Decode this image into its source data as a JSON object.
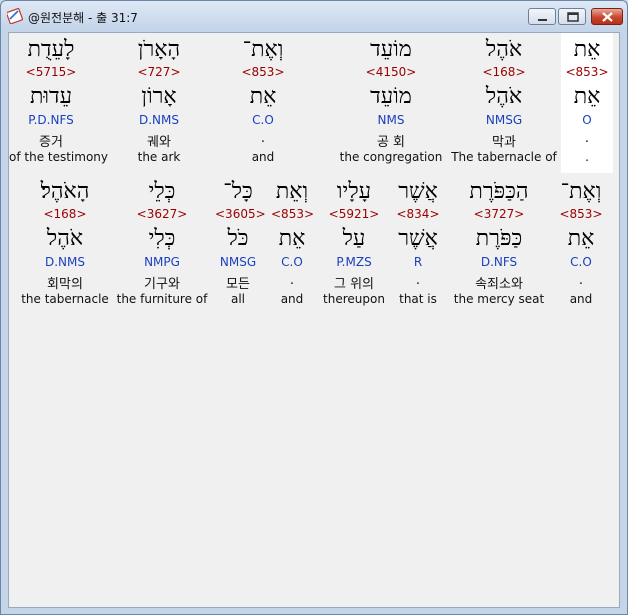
{
  "window": {
    "title": "@원전분해 - 출 31:7"
  },
  "row1": [
    {
      "surface": "לָעֵדֻת",
      "strong": "<5715>",
      "lemma": "עֵדוּת",
      "morph": "P.D.NFS",
      "korean": "증거",
      "english": "of the testimony"
    },
    {
      "surface": "הָאָרֹן",
      "strong": "<727>",
      "lemma": "אָרוֹן",
      "morph": "D.NMS",
      "korean": "궤와",
      "english": "the ark"
    },
    {
      "surface": "וְאֶת־",
      "strong": "<853>",
      "lemma": "אֵת",
      "morph": "C.O",
      "korean": ".",
      "english": "and"
    },
    {
      "surface": "מוֹעֵד",
      "strong": "<4150>",
      "lemma": "מוֹעֵד",
      "morph": "NMS",
      "korean": "공 회",
      "english": "the congregation"
    },
    {
      "surface": "אֹהֶל",
      "strong": "<168>",
      "lemma": "אֹהֶל",
      "morph": "NMSG",
      "korean": "막과",
      "english": "The tabernacle of"
    },
    {
      "surface": "אֵת",
      "strong": "<853>",
      "lemma": "אֵת",
      "morph": "O",
      "korean": ".",
      "english": "."
    }
  ],
  "row2": [
    {
      "surface": "הָאֹהֶל׃",
      "strong": "<168>",
      "lemma": "אֹהֶל",
      "morph": "D.NMS",
      "korean": "회막의",
      "english": "the tabernacle"
    },
    {
      "surface": "כְּלֵי",
      "strong": "<3627>",
      "lemma": "כְּלִי",
      "morph": "NMPG",
      "korean": "기구와",
      "english": "the furniture of"
    },
    {
      "surface": "כָּל־",
      "strong": "<3605>",
      "lemma": "כֹּל",
      "morph": "NMSG",
      "korean": "모든",
      "english": "all"
    },
    {
      "surface": "וְאֵת",
      "strong": "<853>",
      "lemma": "אֵת",
      "morph": "C.O",
      "korean": ".",
      "english": "and"
    },
    {
      "surface": "עָלָיו",
      "strong": "<5921>",
      "lemma": "עַל",
      "morph": "P.MZS",
      "korean": "그 위의",
      "english": "thereupon"
    },
    {
      "surface": "אֲשֶׁר",
      "strong": "<834>",
      "lemma": "אֲשֶׁר",
      "morph": "R",
      "korean": ".",
      "english": "that is"
    },
    {
      "surface": "הַכַּפֹּרֶת",
      "strong": "<3727>",
      "lemma": "כַּפֹּרֶת",
      "morph": "D.NFS",
      "korean": "속죄소와",
      "english": "the mercy seat"
    },
    {
      "surface": "וְאֶת־",
      "strong": "<853>",
      "lemma": "אֵת",
      "morph": "C.O",
      "korean": ".",
      "english": "and"
    }
  ]
}
